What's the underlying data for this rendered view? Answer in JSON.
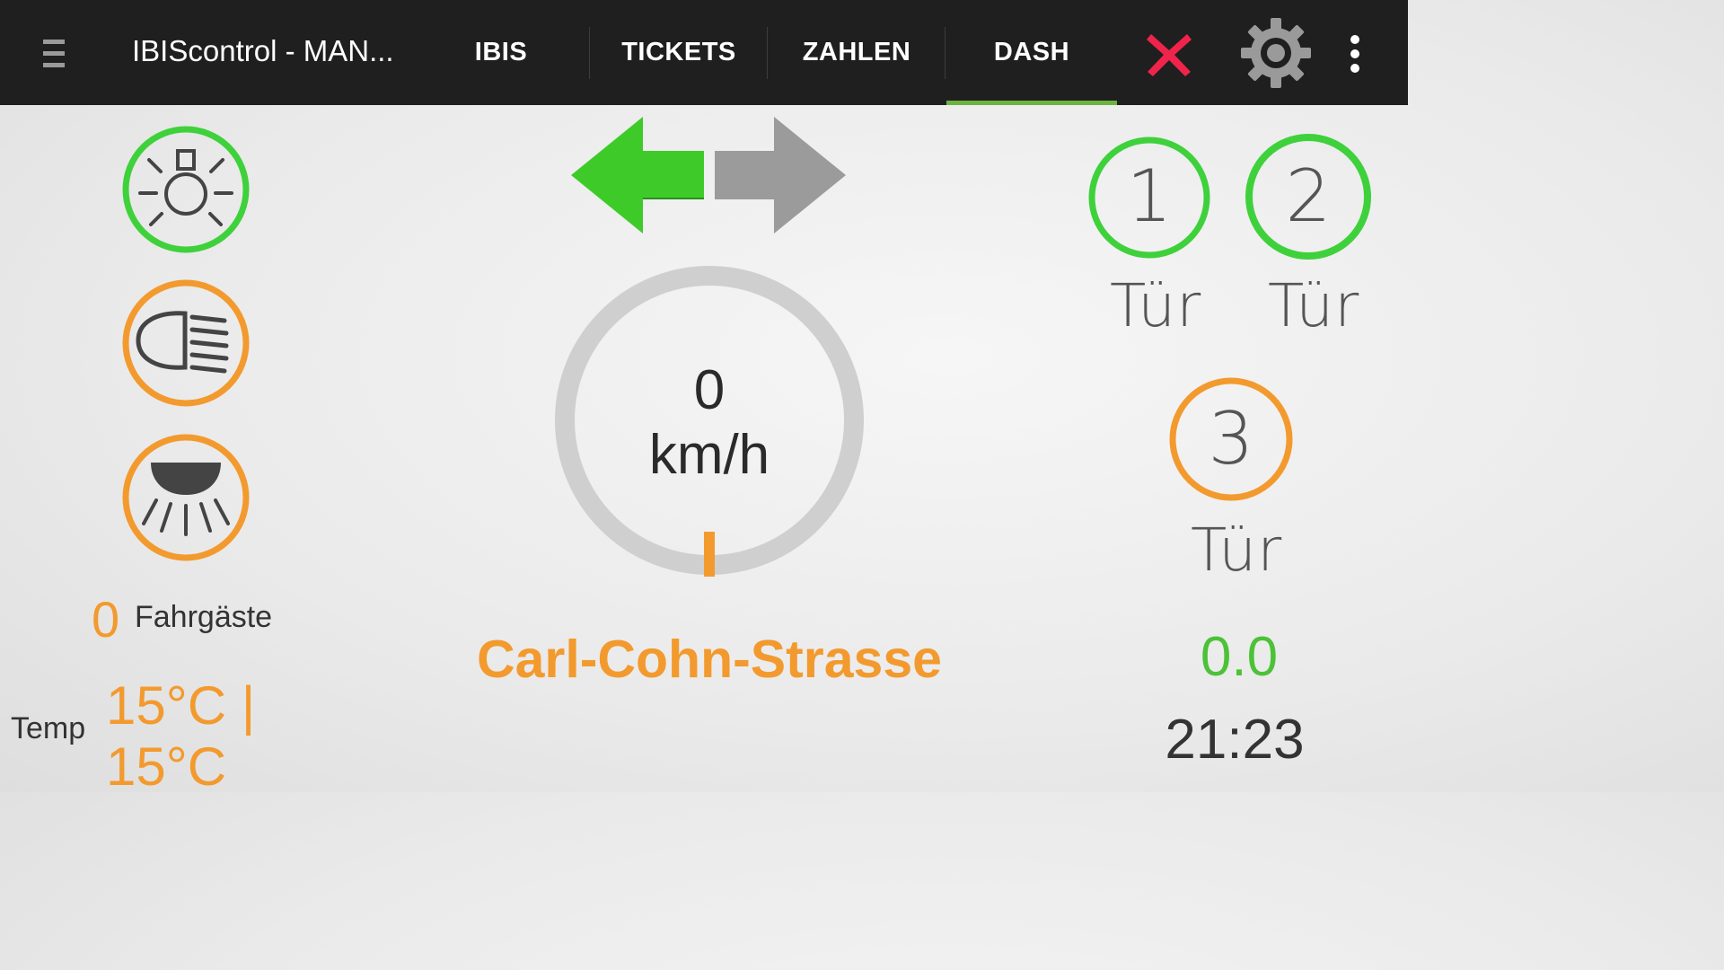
{
  "app": {
    "title": "IBIScontrol - MAN..."
  },
  "tabs": [
    {
      "label": "IBIS"
    },
    {
      "label": "TICKETS"
    },
    {
      "label": "ZAHLEN"
    },
    {
      "label": "DASH",
      "active": true
    }
  ],
  "toolbar": {
    "menu_icon": "hamburger-icon",
    "close_icon": "close-x-icon",
    "settings_icon": "gear-icon",
    "overflow_icon": "more-vert-icon"
  },
  "status_icons": [
    {
      "name": "interior-light-icon",
      "state_color": "#3fd13b"
    },
    {
      "name": "headlight-icon",
      "state_color": "#f39a2e"
    },
    {
      "name": "ceiling-lamp-icon",
      "state_color": "#f39a2e"
    }
  ],
  "direction": {
    "left_active": true,
    "right_active": false,
    "active_color": "#3ecb2a",
    "inactive_color": "#9b9b9b"
  },
  "speed": {
    "value": "0",
    "unit": "km/h"
  },
  "stop": {
    "name": "Carl-Cohn-Strasse"
  },
  "passengers": {
    "count": "0",
    "label": "Fahrgäste"
  },
  "temperature": {
    "label": "Temp",
    "line1": "15°C |",
    "line2": "15°C"
  },
  "doors": [
    {
      "number": "1",
      "label": "Tür",
      "color": "#3fd13b"
    },
    {
      "number": "2",
      "label": "Tür",
      "color": "#3fd13b"
    },
    {
      "number": "3",
      "label": "Tür",
      "color": "#f39a2e"
    }
  ],
  "readout": {
    "value": "0.0",
    "time": "21:23"
  },
  "colors": {
    "accent_green": "#6db33f",
    "orange": "#f39a2e",
    "green": "#3fd13b",
    "topbar": "#1f1f1f"
  }
}
